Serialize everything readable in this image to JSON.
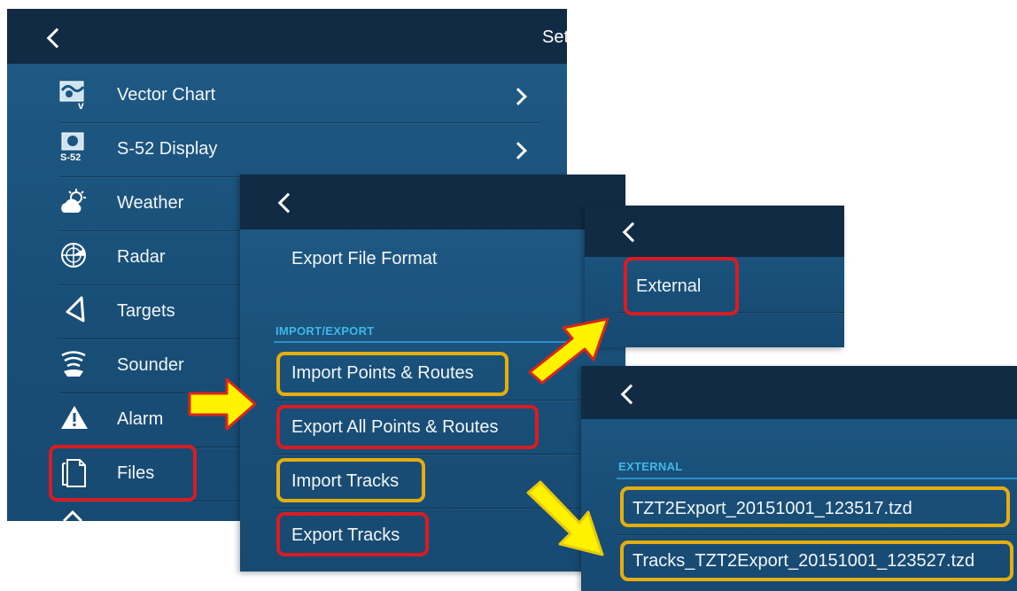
{
  "settings_panel": {
    "title": "Set",
    "items": [
      {
        "label": "Vector Chart",
        "icon": "vector-chart-icon",
        "chevron": true
      },
      {
        "label": "S-52 Display",
        "icon": "s52-display-icon",
        "chevron": true
      },
      {
        "label": "Weather",
        "icon": "weather-icon",
        "chevron": false
      },
      {
        "label": "Radar",
        "icon": "radar-icon",
        "chevron": false
      },
      {
        "label": "Targets",
        "icon": "targets-icon",
        "chevron": false
      },
      {
        "label": "Sounder",
        "icon": "sounder-icon",
        "chevron": false
      },
      {
        "label": "Alarm",
        "icon": "alarm-icon",
        "chevron": false
      },
      {
        "label": "Files",
        "icon": "files-icon",
        "chevron": false
      }
    ]
  },
  "files_panel": {
    "export_format_label": "Export File Format",
    "section_title": "IMPORT/EXPORT",
    "items": [
      {
        "label": "Import Points & Routes"
      },
      {
        "label": "Export All Points & Routes"
      },
      {
        "label": "Import Tracks"
      },
      {
        "label": "Export Tracks"
      }
    ]
  },
  "destination_panel": {
    "items": [
      {
        "label": "External"
      }
    ]
  },
  "external_panel": {
    "section_title": "EXTERNAL",
    "files": [
      {
        "label": "TZT2Export_20151001_123517.tzd"
      },
      {
        "label": "Tracks_TZT2Export_20151001_123527.tzd"
      }
    ]
  },
  "colors": {
    "panel": "#1b5480",
    "header": "#112b44",
    "section_title": "#3fb7e8",
    "highlight_red": "#d61d24",
    "highlight_yellow": "#e6ad0e",
    "arrow_fill": "#fff200"
  }
}
